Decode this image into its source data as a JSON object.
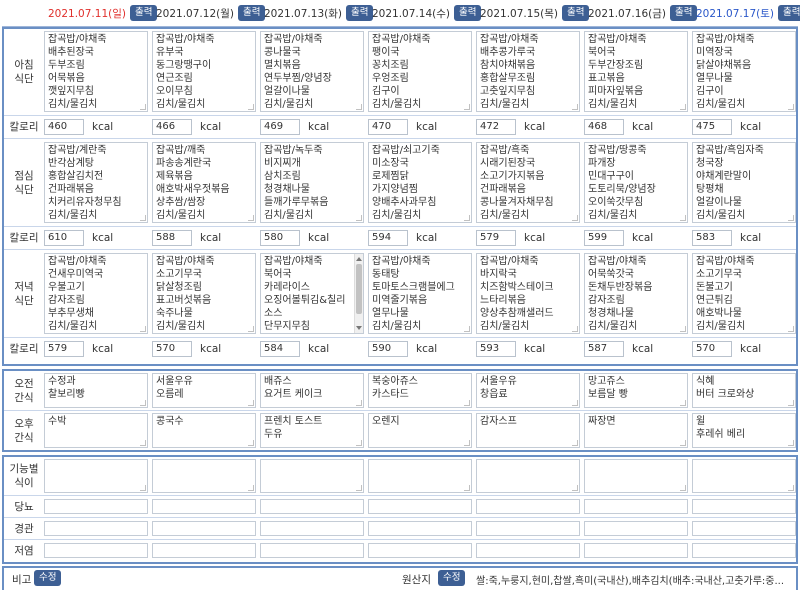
{
  "days": [
    {
      "date": "2021.07.11(일)",
      "type": "sun"
    },
    {
      "date": "2021.07.12(월)",
      "type": "wk"
    },
    {
      "date": "2021.07.13(화)",
      "type": "wk"
    },
    {
      "date": "2021.07.14(수)",
      "type": "wk"
    },
    {
      "date": "2021.07.15(목)",
      "type": "wk"
    },
    {
      "date": "2021.07.16(금)",
      "type": "wk"
    },
    {
      "date": "2021.07.17(토)",
      "type": "sat"
    }
  ],
  "print_label": "출력",
  "labels": {
    "breakfast": "아침\n식단",
    "lunch": "점심\n식단",
    "dinner": "저녁\n식단",
    "calorie": "칼로리",
    "am_snack": "오전\n간식",
    "pm_snack": "오후\n간식",
    "functional": "기능별\n식이",
    "diabetic": "당뇨",
    "tube": "경관",
    "low_salt": "저염",
    "remark": "비고",
    "origin": "원산지"
  },
  "kcal": "kcal",
  "edit_label": "수정",
  "breakfast": [
    [
      "잡곡밥/야채죽",
      "배추된장국",
      "두부조림",
      "어묵볶음",
      "깻잎지무침",
      "김치/물김치"
    ],
    [
      "잡곡밥/야채죽",
      "유부국",
      "동그랑땡구이",
      "연근조림",
      "오이무침",
      "김치/물김치"
    ],
    [
      "잡곡밥/야채죽",
      "콩나물국",
      "멸치볶음",
      "연두부찜/양념장",
      "얼갈이나물",
      "김치/물김치"
    ],
    [
      "잡곡밥/야채죽",
      "팽이국",
      "꽁치조림",
      "우엉조림",
      "김구이",
      "김치/물김치"
    ],
    [
      "잡곡밥/야채죽",
      "배추콩가루국",
      "참치야채볶음",
      "홍합살무조림",
      "고춧잎지무침",
      "김치/물김치"
    ],
    [
      "잡곡밥/야채죽",
      "북어국",
      "두부간장조림",
      "표고볶음",
      "피마자잎볶음",
      "김치/물김치"
    ],
    [
      "잡곡밥/야채죽",
      "미역장국",
      "닭살야채볶음",
      "열무나물",
      "김구이",
      "김치/물김치"
    ]
  ],
  "breakfast_kcal": [
    "460",
    "466",
    "469",
    "470",
    "472",
    "468",
    "475"
  ],
  "lunch": [
    [
      "잡곡밥/계란죽",
      "반각삼계탕",
      "홍합살김치전",
      "건파래볶음",
      "치커리유자청무침",
      "김치/물김치"
    ],
    [
      "잡곡밥/깨죽",
      "파송송계란국",
      "제육볶음",
      "애호박새우젓볶음",
      "상추쌈/쌈장",
      "김치/물김치"
    ],
    [
      "잡곡밥/녹두죽",
      "비지찌개",
      "삼치조림",
      "청경채나물",
      "들깨가루무볶음",
      "김치/물김치"
    ],
    [
      "잡곡밥/쇠고기죽",
      "미소장국",
      "로제찜닭",
      "가지양념찜",
      "양배추사과무침",
      "김치/물김치"
    ],
    [
      "잡곡밥/흑죽",
      "시래기된장국",
      "소고기가지볶음",
      "건파래볶음",
      "콩나물겨자채무침",
      "김치/물김치"
    ],
    [
      "잡곡밥/땅콩죽",
      "파개장",
      "민대구구이",
      "도토리묵/양념장",
      "오이쑥갓무침",
      "김치/물김치"
    ],
    [
      "잡곡밥/흑임자죽",
      "청국장",
      "야채계란말이",
      "탕평채",
      "얼갈이나물",
      "김치/물김치"
    ]
  ],
  "lunch_kcal": [
    "610",
    "588",
    "580",
    "594",
    "579",
    "599",
    "583"
  ],
  "dinner": [
    [
      "잡곡밥/야채죽",
      "건새우미역국",
      "우불고기",
      "감자조림",
      "부추무생채",
      "김치/물김치"
    ],
    [
      "잡곡밥/야채죽",
      "소고기무국",
      "닭살청조림",
      "표고버섯볶음",
      "숙주나물",
      "김치/물김치"
    ],
    [
      "잡곡밥/야채죽",
      "북어국",
      "카레라이스",
      "오징어볼튀김&칠리",
      "소스",
      "단무지무침"
    ],
    [
      "잡곡밥/야채죽",
      "동태탕",
      "토마토스크램블에그",
      "미역줄기볶음",
      "열무나물",
      "김치/물김치"
    ],
    [
      "잡곡밥/야채죽",
      "바지락국",
      "치즈함박스테이크",
      "느타리볶음",
      "양상추참깨샐러드",
      "김치/물김치"
    ],
    [
      "잡곡밥/야채죽",
      "어묵쑥갓국",
      "돈채두반장볶음",
      "감자조림",
      "청경채나물",
      "김치/물김치"
    ],
    [
      "잡곡밥/야채죽",
      "소고기무국",
      "돈불고기",
      "연근튀김",
      "애호박나물",
      "김치/물김치"
    ]
  ],
  "dinner_kcal": [
    "579",
    "570",
    "584",
    "590",
    "593",
    "587",
    "570"
  ],
  "am_snack": [
    [
      "수정과",
      "찰보리빵"
    ],
    [
      "서울우유",
      "오름레"
    ],
    [
      "배쥬스",
      "요거트 케이크"
    ],
    [
      "복숭아쥬스",
      "카스타드"
    ],
    [
      "서울우유",
      "창읍료"
    ],
    [
      "망고쥬스",
      "보름달 빵"
    ],
    [
      "식혜",
      "버터 크로와상"
    ]
  ],
  "pm_snack": [
    [
      "수박"
    ],
    [
      "콩국수"
    ],
    [
      "프렌치 토스트",
      "두유"
    ],
    [
      "오렌지"
    ],
    [
      "감자스프"
    ],
    [
      "짜장면"
    ],
    [
      "윌",
      "후레쉬 베리"
    ]
  ],
  "origin_text": "쌀:죽,누룽지,현미,찹쌀,흑미(국내산),배추김치(배추:국내산,고춧가루:중..."
}
